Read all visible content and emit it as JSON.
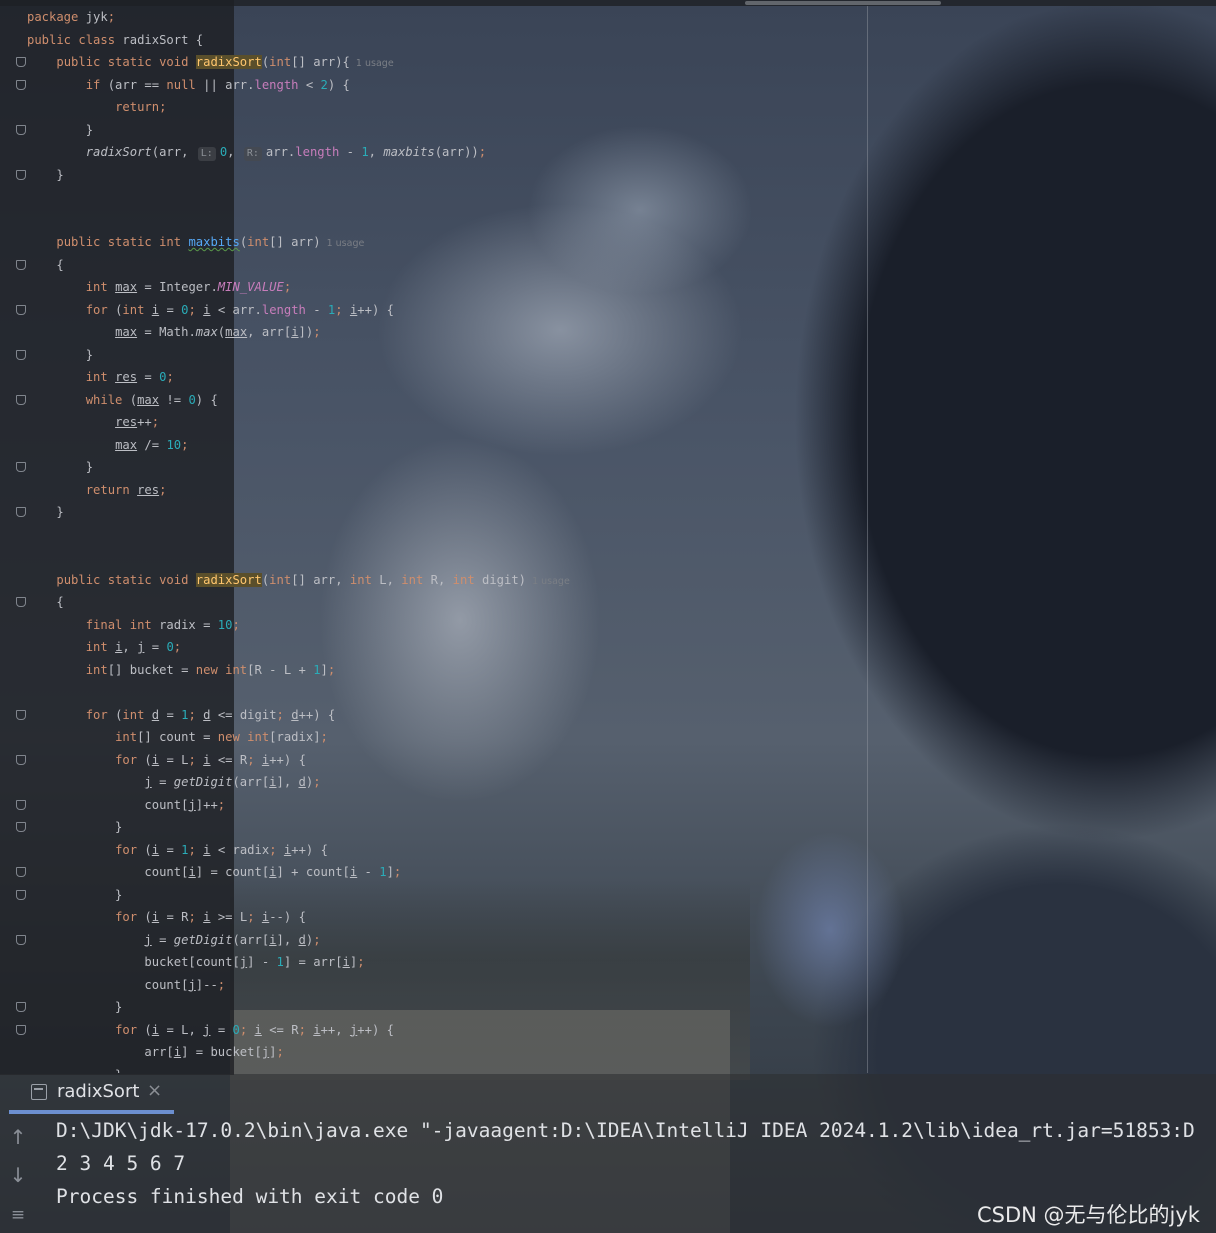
{
  "editor": {
    "lines": [
      [
        {
          "t": "package ",
          "c": "k"
        },
        {
          "t": "jyk"
        },
        {
          "t": ";",
          "c": "k"
        }
      ],
      [
        {
          "t": "public class ",
          "c": "k"
        },
        {
          "t": "radixSort {"
        }
      ],
      [
        {
          "t": "    "
        },
        {
          "t": "public static void ",
          "c": "k"
        },
        {
          "t": "radixSort",
          "c": "hl"
        },
        {
          "t": "("
        },
        {
          "t": "int",
          "c": "k"
        },
        {
          "t": "[] arr){"
        },
        {
          "t": "  1 usage",
          "c": "hint"
        }
      ],
      [
        {
          "t": "        "
        },
        {
          "t": "if ",
          "c": "k"
        },
        {
          "t": "(arr == "
        },
        {
          "t": "null",
          "c": "k"
        },
        {
          "t": " || arr."
        },
        {
          "t": "length",
          "c": "pf2"
        },
        {
          "t": " < "
        },
        {
          "t": "2",
          "c": "n"
        },
        {
          "t": ") {"
        }
      ],
      [
        {
          "t": "            "
        },
        {
          "t": "return",
          "c": "k"
        },
        {
          "t": ";",
          "c": "k"
        }
      ],
      [
        {
          "t": "        }"
        }
      ],
      [
        {
          "t": "        "
        },
        {
          "t": "radixSort",
          "c": "it"
        },
        {
          "t": "(arr, "
        },
        {
          "t": "L:",
          "c": "ph"
        },
        {
          "t": "0",
          "c": "n"
        },
        {
          "t": ", "
        },
        {
          "t": "R:",
          "c": "ph"
        },
        {
          "t": "arr."
        },
        {
          "t": "length",
          "c": "pf2"
        },
        {
          "t": " - "
        },
        {
          "t": "1",
          "c": "n"
        },
        {
          "t": ", "
        },
        {
          "t": "maxbits",
          "c": "it"
        },
        {
          "t": "(arr))"
        },
        {
          "t": ";",
          "c": "k"
        }
      ],
      [
        {
          "t": "    }"
        }
      ],
      [],
      [],
      [
        {
          "t": "    "
        },
        {
          "t": "public static int ",
          "c": "k"
        },
        {
          "t": "maxbits",
          "c": "f uw"
        },
        {
          "t": "("
        },
        {
          "t": "int",
          "c": "k"
        },
        {
          "t": "[] arr)"
        },
        {
          "t": "  1 usage",
          "c": "hint"
        }
      ],
      [
        {
          "t": "    {"
        }
      ],
      [
        {
          "t": "        "
        },
        {
          "t": "int ",
          "c": "k"
        },
        {
          "t": "max",
          "c": "u"
        },
        {
          "t": " = Integer."
        },
        {
          "t": "MIN_VALUE",
          "c": "pf"
        },
        {
          "t": ";",
          "c": "k"
        }
      ],
      [
        {
          "t": "        "
        },
        {
          "t": "for ",
          "c": "k"
        },
        {
          "t": "("
        },
        {
          "t": "int ",
          "c": "k"
        },
        {
          "t": "i",
          "c": "u"
        },
        {
          "t": " = "
        },
        {
          "t": "0",
          "c": "n"
        },
        {
          "t": "; ",
          "c": "k"
        },
        {
          "t": "i",
          "c": "u"
        },
        {
          "t": " < arr."
        },
        {
          "t": "length",
          "c": "pf2"
        },
        {
          "t": " - "
        },
        {
          "t": "1",
          "c": "n"
        },
        {
          "t": "; ",
          "c": "k"
        },
        {
          "t": "i",
          "c": "u"
        },
        {
          "t": "++) {"
        }
      ],
      [
        {
          "t": "            "
        },
        {
          "t": "max",
          "c": "u"
        },
        {
          "t": " = Math."
        },
        {
          "t": "max",
          "c": "it"
        },
        {
          "t": "("
        },
        {
          "t": "max",
          "c": "u"
        },
        {
          "t": ", arr["
        },
        {
          "t": "i",
          "c": "u"
        },
        {
          "t": "])"
        },
        {
          "t": ";",
          "c": "k"
        }
      ],
      [
        {
          "t": "        }"
        }
      ],
      [
        {
          "t": "        "
        },
        {
          "t": "int ",
          "c": "k"
        },
        {
          "t": "res",
          "c": "u"
        },
        {
          "t": " = "
        },
        {
          "t": "0",
          "c": "n"
        },
        {
          "t": ";",
          "c": "k"
        }
      ],
      [
        {
          "t": "        "
        },
        {
          "t": "while ",
          "c": "k"
        },
        {
          "t": "("
        },
        {
          "t": "max",
          "c": "u"
        },
        {
          "t": " != "
        },
        {
          "t": "0",
          "c": "n"
        },
        {
          "t": ") {"
        }
      ],
      [
        {
          "t": "            "
        },
        {
          "t": "res",
          "c": "u"
        },
        {
          "t": "++"
        },
        {
          "t": ";",
          "c": "k"
        }
      ],
      [
        {
          "t": "            "
        },
        {
          "t": "max",
          "c": "u"
        },
        {
          "t": " /= "
        },
        {
          "t": "10",
          "c": "n"
        },
        {
          "t": ";",
          "c": "k"
        }
      ],
      [
        {
          "t": "        }"
        }
      ],
      [
        {
          "t": "        "
        },
        {
          "t": "return ",
          "c": "k"
        },
        {
          "t": "res",
          "c": "u"
        },
        {
          "t": ";",
          "c": "k"
        }
      ],
      [
        {
          "t": "    }"
        }
      ],
      [],
      [],
      [
        {
          "t": "    "
        },
        {
          "t": "public static void ",
          "c": "k"
        },
        {
          "t": "radixSort",
          "c": "hl"
        },
        {
          "t": "("
        },
        {
          "t": "int",
          "c": "k"
        },
        {
          "t": "[] arr, "
        },
        {
          "t": "int ",
          "c": "k"
        },
        {
          "t": "L, "
        },
        {
          "t": "int ",
          "c": "k"
        },
        {
          "t": "R, "
        },
        {
          "t": "int ",
          "c": "k"
        },
        {
          "t": "digit)"
        },
        {
          "t": "  1 usage",
          "c": "hint"
        }
      ],
      [
        {
          "t": "    {"
        }
      ],
      [
        {
          "t": "        "
        },
        {
          "t": "final int ",
          "c": "k"
        },
        {
          "t": "radix = "
        },
        {
          "t": "10",
          "c": "n"
        },
        {
          "t": ";",
          "c": "k"
        }
      ],
      [
        {
          "t": "        "
        },
        {
          "t": "int ",
          "c": "k"
        },
        {
          "t": "i",
          "c": "u"
        },
        {
          "t": ", "
        },
        {
          "t": "j",
          "c": "u"
        },
        {
          "t": " = "
        },
        {
          "t": "0",
          "c": "n"
        },
        {
          "t": ";",
          "c": "k"
        }
      ],
      [
        {
          "t": "        "
        },
        {
          "t": "int",
          "c": "k"
        },
        {
          "t": "[] bucket = "
        },
        {
          "t": "new int",
          "c": "k"
        },
        {
          "t": "[R - L + "
        },
        {
          "t": "1",
          "c": "n"
        },
        {
          "t": "]"
        },
        {
          "t": ";",
          "c": "k"
        }
      ],
      [],
      [
        {
          "t": "        "
        },
        {
          "t": "for ",
          "c": "k"
        },
        {
          "t": "("
        },
        {
          "t": "int ",
          "c": "k"
        },
        {
          "t": "d",
          "c": "u"
        },
        {
          "t": " = "
        },
        {
          "t": "1",
          "c": "n"
        },
        {
          "t": "; ",
          "c": "k"
        },
        {
          "t": "d",
          "c": "u"
        },
        {
          "t": " <= digit"
        },
        {
          "t": "; ",
          "c": "k"
        },
        {
          "t": "d",
          "c": "u"
        },
        {
          "t": "++) {"
        }
      ],
      [
        {
          "t": "            "
        },
        {
          "t": "int",
          "c": "k"
        },
        {
          "t": "[] count = "
        },
        {
          "t": "new int",
          "c": "k"
        },
        {
          "t": "[radix]"
        },
        {
          "t": ";",
          "c": "k"
        }
      ],
      [
        {
          "t": "            "
        },
        {
          "t": "for ",
          "c": "k"
        },
        {
          "t": "("
        },
        {
          "t": "i",
          "c": "u"
        },
        {
          "t": " = L"
        },
        {
          "t": "; ",
          "c": "k"
        },
        {
          "t": "i",
          "c": "u"
        },
        {
          "t": " <= R"
        },
        {
          "t": "; ",
          "c": "k"
        },
        {
          "t": "i",
          "c": "u"
        },
        {
          "t": "++) {"
        }
      ],
      [
        {
          "t": "                "
        },
        {
          "t": "j",
          "c": "u"
        },
        {
          "t": " = "
        },
        {
          "t": "getDigit",
          "c": "it"
        },
        {
          "t": "(arr["
        },
        {
          "t": "i",
          "c": "u"
        },
        {
          "t": "], "
        },
        {
          "t": "d",
          "c": "u"
        },
        {
          "t": ")"
        },
        {
          "t": ";",
          "c": "k"
        }
      ],
      [
        {
          "t": "                count["
        },
        {
          "t": "j",
          "c": "u"
        },
        {
          "t": "]++"
        },
        {
          "t": ";",
          "c": "k"
        }
      ],
      [
        {
          "t": "            }"
        }
      ],
      [
        {
          "t": "            "
        },
        {
          "t": "for ",
          "c": "k"
        },
        {
          "t": "("
        },
        {
          "t": "i",
          "c": "u"
        },
        {
          "t": " = "
        },
        {
          "t": "1",
          "c": "n"
        },
        {
          "t": "; ",
          "c": "k"
        },
        {
          "t": "i",
          "c": "u"
        },
        {
          "t": " < radix"
        },
        {
          "t": "; ",
          "c": "k"
        },
        {
          "t": "i",
          "c": "u"
        },
        {
          "t": "++) {"
        }
      ],
      [
        {
          "t": "                count["
        },
        {
          "t": "i",
          "c": "u"
        },
        {
          "t": "] = count["
        },
        {
          "t": "i",
          "c": "u"
        },
        {
          "t": "] + count["
        },
        {
          "t": "i",
          "c": "u"
        },
        {
          "t": " - "
        },
        {
          "t": "1",
          "c": "n"
        },
        {
          "t": "]"
        },
        {
          "t": ";",
          "c": "k"
        }
      ],
      [
        {
          "t": "            }"
        }
      ],
      [
        {
          "t": "            "
        },
        {
          "t": "for ",
          "c": "k"
        },
        {
          "t": "("
        },
        {
          "t": "i",
          "c": "u"
        },
        {
          "t": " = R"
        },
        {
          "t": "; ",
          "c": "k"
        },
        {
          "t": "i",
          "c": "u"
        },
        {
          "t": " >= L"
        },
        {
          "t": "; ",
          "c": "k"
        },
        {
          "t": "i",
          "c": "u"
        },
        {
          "t": "--) {"
        }
      ],
      [
        {
          "t": "                "
        },
        {
          "t": "j",
          "c": "u"
        },
        {
          "t": " = "
        },
        {
          "t": "getDigit",
          "c": "it"
        },
        {
          "t": "(arr["
        },
        {
          "t": "i",
          "c": "u"
        },
        {
          "t": "], "
        },
        {
          "t": "d",
          "c": "u"
        },
        {
          "t": ")"
        },
        {
          "t": ";",
          "c": "k"
        }
      ],
      [
        {
          "t": "                bucket[count["
        },
        {
          "t": "j",
          "c": "u"
        },
        {
          "t": "] - "
        },
        {
          "t": "1",
          "c": "n"
        },
        {
          "t": "] = arr["
        },
        {
          "t": "i",
          "c": "u"
        },
        {
          "t": "]"
        },
        {
          "t": ";",
          "c": "k"
        }
      ],
      [
        {
          "t": "                count["
        },
        {
          "t": "j",
          "c": "u"
        },
        {
          "t": "]--"
        },
        {
          "t": ";",
          "c": "k"
        }
      ],
      [
        {
          "t": "            }"
        }
      ],
      [
        {
          "t": "            "
        },
        {
          "t": "for ",
          "c": "k"
        },
        {
          "t": "("
        },
        {
          "t": "i",
          "c": "u"
        },
        {
          "t": " = L, "
        },
        {
          "t": "j",
          "c": "u"
        },
        {
          "t": " = "
        },
        {
          "t": "0",
          "c": "n"
        },
        {
          "t": "; ",
          "c": "k"
        },
        {
          "t": "i",
          "c": "u"
        },
        {
          "t": " <= R"
        },
        {
          "t": "; ",
          "c": "k"
        },
        {
          "t": "i",
          "c": "u"
        },
        {
          "t": "++, "
        },
        {
          "t": "j",
          "c": "u"
        },
        {
          "t": "++) {"
        }
      ],
      [
        {
          "t": "                arr["
        },
        {
          "t": "i",
          "c": "u"
        },
        {
          "t": "] = bucket["
        },
        {
          "t": "j",
          "c": "u"
        },
        {
          "t": "]"
        },
        {
          "t": ";",
          "c": "k"
        }
      ],
      [
        {
          "t": "            }"
        }
      ]
    ],
    "fold_lines": [
      2,
      3,
      5,
      7,
      11,
      13,
      15,
      17,
      20,
      22,
      26,
      31,
      33,
      35,
      36,
      38,
      39,
      41,
      44,
      45
    ]
  },
  "run_panel": {
    "tab_label": "radixSort",
    "close_glyph": "×",
    "icons": [
      "arrow-up-icon",
      "arrow-down-icon",
      "soft-wrap-icon"
    ],
    "output": [
      "D:\\JDK\\jdk-17.0.2\\bin\\java.exe \"-javaagent:D:\\IDEA\\IntelliJ IDEA 2024.1.2\\lib\\idea_rt.jar=51853:D",
      "2 3 4 5 6 7",
      "Process finished with exit code 0"
    ]
  },
  "watermark": "CSDN @无与伦比的jyk"
}
